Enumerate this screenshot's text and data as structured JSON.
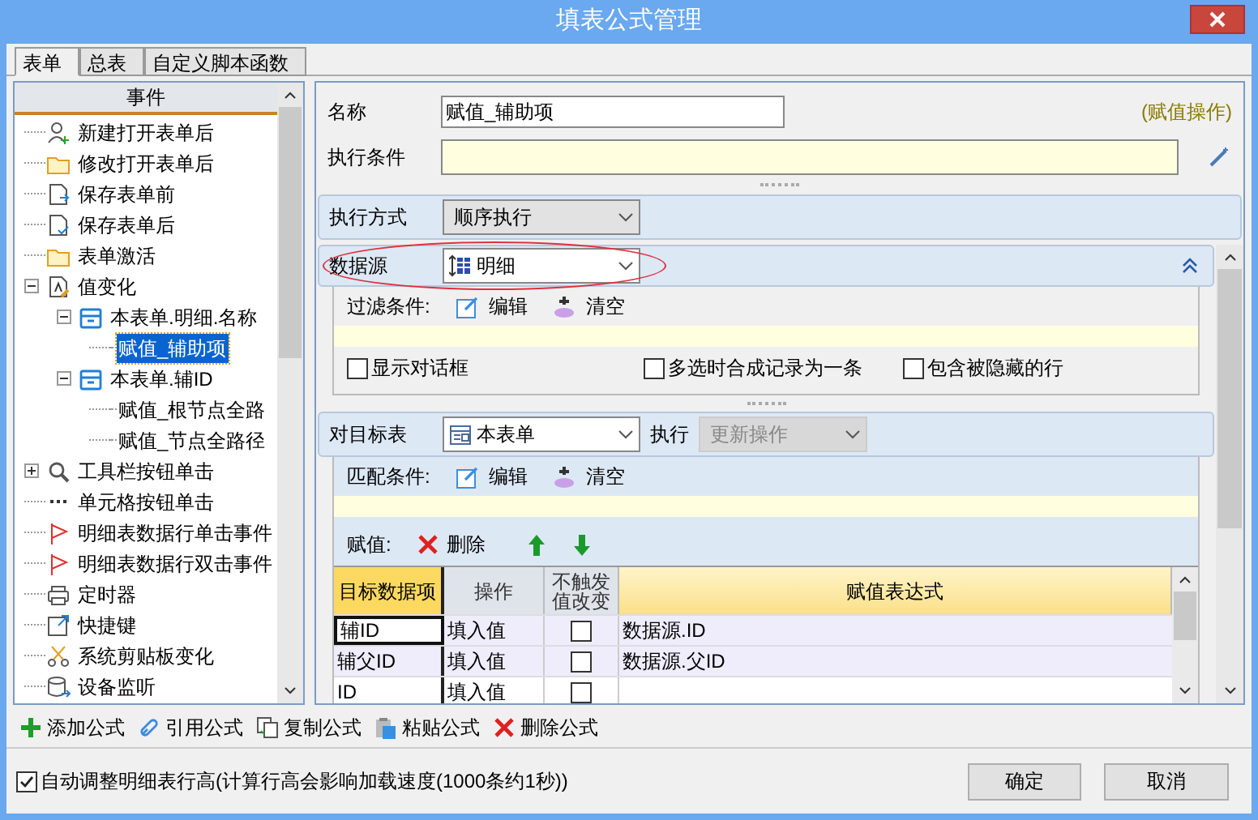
{
  "window": {
    "title": "填表公式管理"
  },
  "tabs": [
    {
      "label": "表单",
      "selected": true
    },
    {
      "label": "总表",
      "selected": false
    },
    {
      "label": "自定义脚本函数",
      "selected": false
    }
  ],
  "events": {
    "header": "事件",
    "items": [
      {
        "label": "新建打开表单后",
        "kind": "user",
        "selected": false
      },
      {
        "label": "修改打开表单后",
        "kind": "folder",
        "selected": false
      },
      {
        "label": "保存表单前",
        "kind": "save",
        "selected": false
      },
      {
        "label": "保存表单后",
        "kind": "saved",
        "selected": false
      },
      {
        "label": "表单激活",
        "kind": "folder",
        "selected": false
      },
      {
        "label": "值变化",
        "kind": "doc",
        "selected": false,
        "expanded": true,
        "children": [
          {
            "label": "本表单.明细.名称",
            "kind": "table",
            "selected": false,
            "expanded": true,
            "children": [
              {
                "label": "赋值_辅助项",
                "selected": true
              }
            ]
          },
          {
            "label": "本表单.辅ID",
            "kind": "table",
            "selected": false,
            "expanded": true,
            "children": [
              {
                "label": "赋值_根节点全路",
                "selected": false
              },
              {
                "label": "赋值_节点全路径",
                "selected": false
              }
            ]
          }
        ]
      },
      {
        "label": "工具栏按钮单击",
        "kind": "search",
        "selected": false,
        "expanded": false
      },
      {
        "label": "单元格按钮单击",
        "kind": "dots",
        "selected": false
      },
      {
        "label": "明细表数据行单击事件",
        "kind": "flag",
        "selected": false
      },
      {
        "label": "明细表数据行双击事件",
        "kind": "flag",
        "selected": false
      },
      {
        "label": "定时器",
        "kind": "printer",
        "selected": false
      },
      {
        "label": "快捷键",
        "kind": "shortcut",
        "selected": false
      },
      {
        "label": "系统剪贴板变化",
        "kind": "scissors",
        "selected": false
      },
      {
        "label": "设备监听",
        "kind": "device",
        "selected": false
      }
    ]
  },
  "form": {
    "name_label": "名称",
    "name_value": "赋值_辅助项",
    "type_note": "(赋值操作)",
    "condition_label": "执行条件",
    "mode_label": "执行方式",
    "mode_value": "顺序执行"
  },
  "data_source": {
    "label": "数据源",
    "value": "明细",
    "highlighted": true,
    "expanded": true,
    "filter_label": "过滤条件:",
    "edit": "编辑",
    "clear": "清空",
    "options": [
      {
        "label": "显示对话框",
        "checked": false
      },
      {
        "label": "多选时合成记录为一条",
        "checked": false
      },
      {
        "label": "包含被隐藏的行",
        "checked": false
      }
    ]
  },
  "target": {
    "label": "对目标表",
    "value": "本表单",
    "exec_label": "执行",
    "exec_value": "更新操作",
    "exec_disabled": true,
    "match_label": "匹配条件:",
    "edit": "编辑",
    "clear": "清空",
    "assign_label": "赋值:",
    "delete": "删除"
  },
  "grid": {
    "columns": [
      {
        "label": "目标数据项",
        "selected": true
      },
      {
        "label": "操作",
        "selected": false
      },
      {
        "label": "不触发值改变",
        "selected": false
      },
      {
        "label": "赋值表达式",
        "selected": false
      }
    ],
    "rows": [
      {
        "target": "辅ID",
        "operation": "填入值",
        "no_trigger": false,
        "expression": "数据源.ID",
        "highlighted": true,
        "focused": true
      },
      {
        "target": "辅父ID",
        "operation": "填入值",
        "no_trigger": false,
        "expression": "数据源.父ID",
        "highlighted": true,
        "focused": false
      },
      {
        "target": "ID",
        "operation": "填入值",
        "no_trigger": false,
        "highlighted": false,
        "focused": false
      }
    ]
  },
  "toolbar": [
    {
      "kind": "add",
      "label": "添加公式"
    },
    {
      "kind": "link",
      "label": "引用公式"
    },
    {
      "kind": "copy",
      "label": "复制公式"
    },
    {
      "kind": "paste",
      "label": "粘贴公式"
    },
    {
      "kind": "delete",
      "label": "删除公式"
    }
  ],
  "auto_height": {
    "label": "自动调整明细表行高(计算行高会影响加载速度(1000条约1秒))",
    "checked": true
  },
  "buttons": [
    "确定",
    "取消"
  ]
}
